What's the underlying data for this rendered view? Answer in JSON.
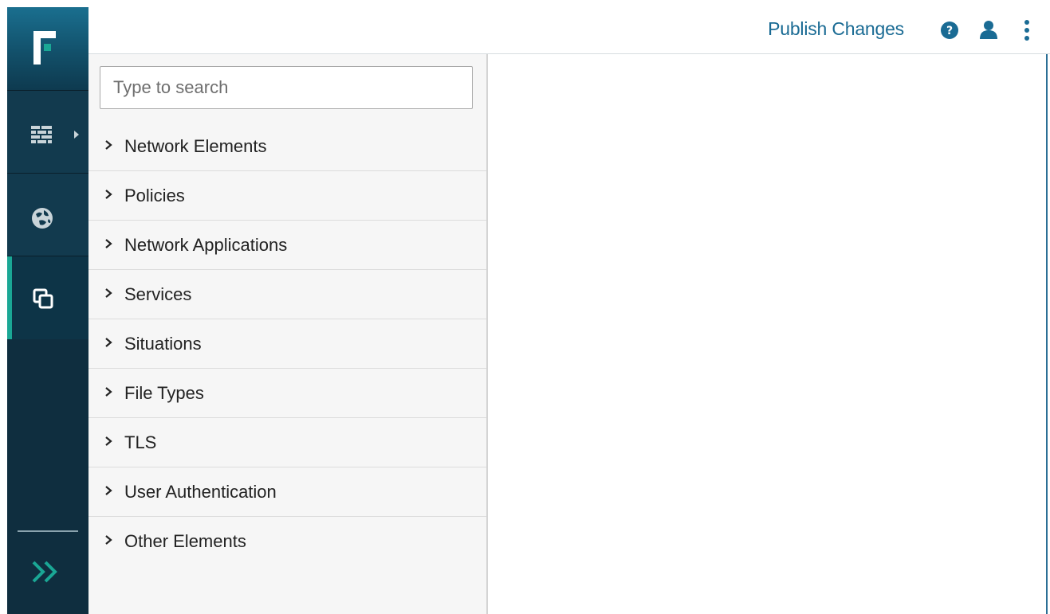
{
  "topbar": {
    "publish_label": "Publish Changes",
    "help_icon": "help-icon",
    "user_icon": "user-icon",
    "more_icon": "more-vertical-icon",
    "accent_color": "#1a6b94"
  },
  "rail": {
    "logo_icon": "forcepoint-logo",
    "items": [
      {
        "icon": "firewall-icon",
        "has_arrow": true
      },
      {
        "icon": "globe-icon"
      },
      {
        "icon": "overlap-squares-icon",
        "active": true
      }
    ],
    "expand_icon": "double-chevron-right-icon",
    "active_color": "#1aa795"
  },
  "panel": {
    "search": {
      "placeholder": "Type to search",
      "value": ""
    },
    "items": [
      {
        "label": "Network Elements"
      },
      {
        "label": "Policies"
      },
      {
        "label": "Network Applications"
      },
      {
        "label": "Services"
      },
      {
        "label": "Situations"
      },
      {
        "label": "File Types"
      },
      {
        "label": "TLS"
      },
      {
        "label": "User Authentication"
      },
      {
        "label": "Other Elements"
      }
    ]
  }
}
